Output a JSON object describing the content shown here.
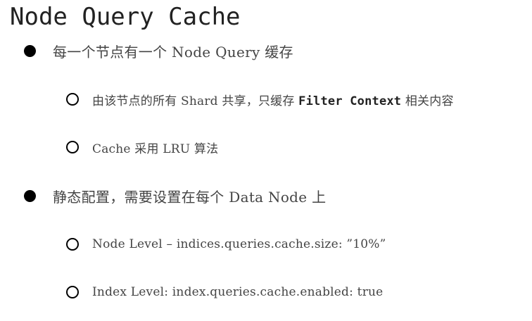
{
  "title": "Node Query Cache",
  "bullets": [
    {
      "text": "每一个节点有一个 Node Query 缓存",
      "sub": [
        {
          "prefix": "由该节点的所有 Shard 共享，只缓存 ",
          "bold": "Filter Context",
          "suffix": " 相关内容"
        },
        {
          "text": "Cache 采用 LRU 算法"
        }
      ]
    },
    {
      "text": "静态配置，需要设置在每个 Data Node 上",
      "sub": [
        {
          "text": "Node Level – indices.queries.cache.size: ”10%”"
        },
        {
          "text": "Index Level: index.queries.cache.enabled: true"
        }
      ]
    }
  ]
}
